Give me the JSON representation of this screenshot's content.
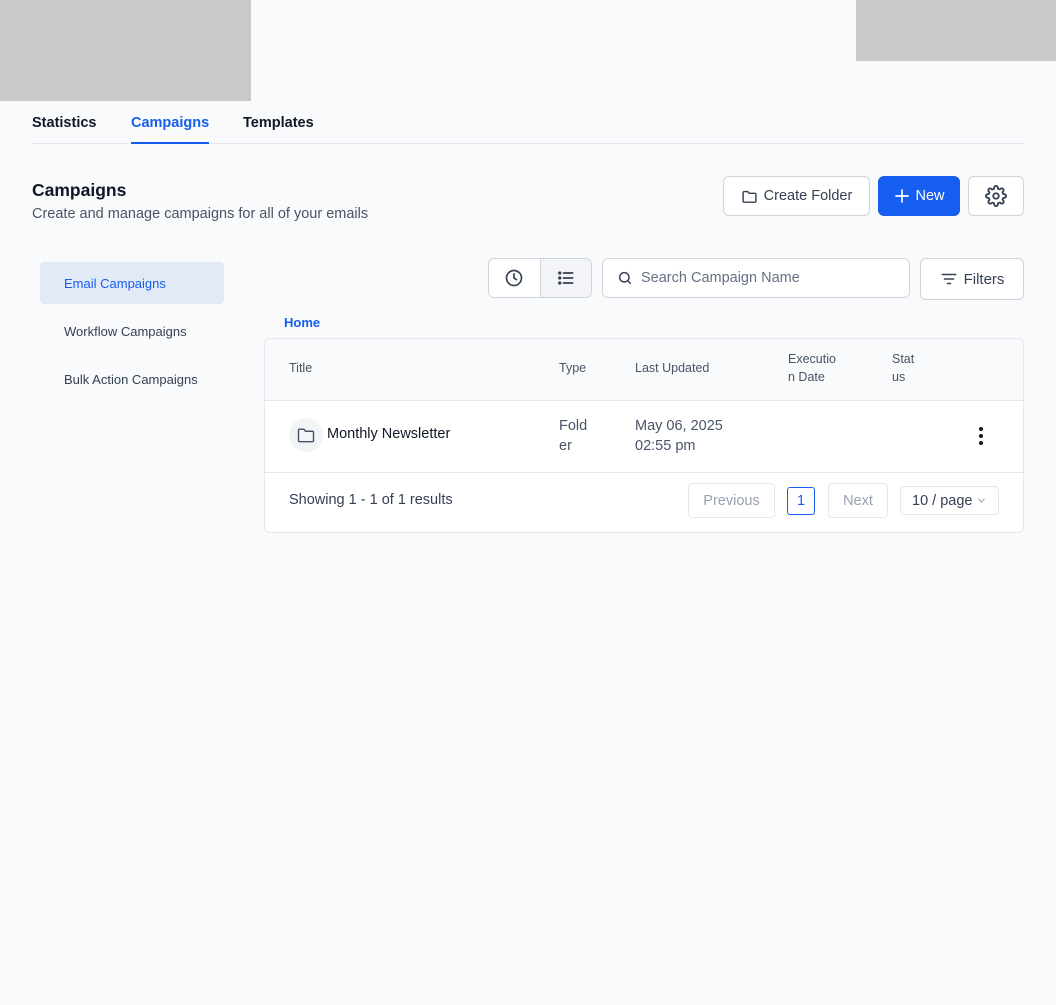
{
  "tabs": [
    {
      "label": "Statistics"
    },
    {
      "label": "Campaigns"
    },
    {
      "label": "Templates"
    }
  ],
  "header": {
    "title": "Campaigns",
    "subtitle": "Create and manage campaigns for all of your emails",
    "create_folder_label": "Create Folder",
    "new_label": "New"
  },
  "sidebar": {
    "items": [
      {
        "label": "Email Campaigns"
      },
      {
        "label": "Workflow Campaigns"
      },
      {
        "label": "Bulk Action Campaigns"
      }
    ]
  },
  "toolbar": {
    "search_placeholder": "Search Campaign Name",
    "filters_label": "Filters"
  },
  "breadcrumb": {
    "home": "Home"
  },
  "table": {
    "headers": {
      "title": "Title",
      "type": "Type",
      "last_updated": "Last Updated",
      "execution_date": "Execution Date",
      "status": "Status"
    },
    "rows": [
      {
        "title": "Monthly Newsletter",
        "type": "Folder",
        "updated_date": "May 06, 2025",
        "updated_time": "02:55 pm"
      }
    ]
  },
  "pagination": {
    "showing": "Showing 1 - 1 of 1 results",
    "previous": "Previous",
    "page": "1",
    "next": "Next",
    "page_size": "10 / page"
  },
  "colors": {
    "accent": "#155eef",
    "active_bg": "#e2eaf8",
    "page_bg": "#f9fafb"
  },
  "icons": [
    "folder-icon",
    "plus-icon",
    "gear-icon",
    "clock-icon",
    "list-icon",
    "search-icon",
    "filter-icon",
    "kebab-icon",
    "chevron-down-icon"
  ]
}
